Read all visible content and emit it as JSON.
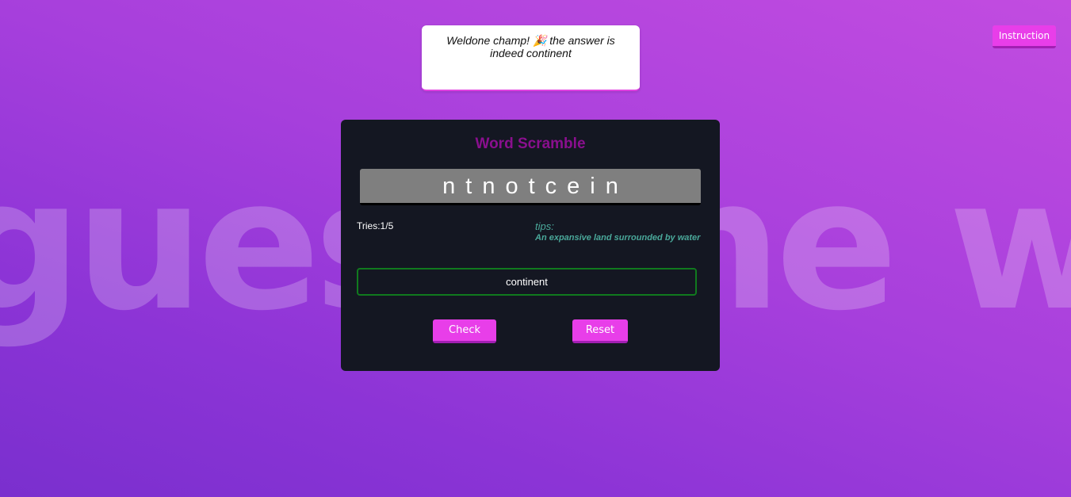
{
  "background": {
    "text": "guess the word"
  },
  "toast": {
    "message": "Weldone champ! 🎉 the answer is indeed continent"
  },
  "header": {
    "instruction_label": "Instruction"
  },
  "game": {
    "title": "Word Scramble",
    "scrambled_word": "ntnotcein",
    "tries_label": "Tries:1/5",
    "tries_used": 1,
    "tries_max": 5,
    "tips_label": "tips:",
    "tips_text": "An expansive land surrounded by water",
    "answer_value": "continent",
    "check_label": "Check",
    "reset_label": "Reset"
  },
  "colors": {
    "accent": "#e83ee9",
    "title": "#8a0f8e",
    "card": "#141722",
    "tips": "#4aa89a",
    "input_border_success": "#107a1e"
  }
}
